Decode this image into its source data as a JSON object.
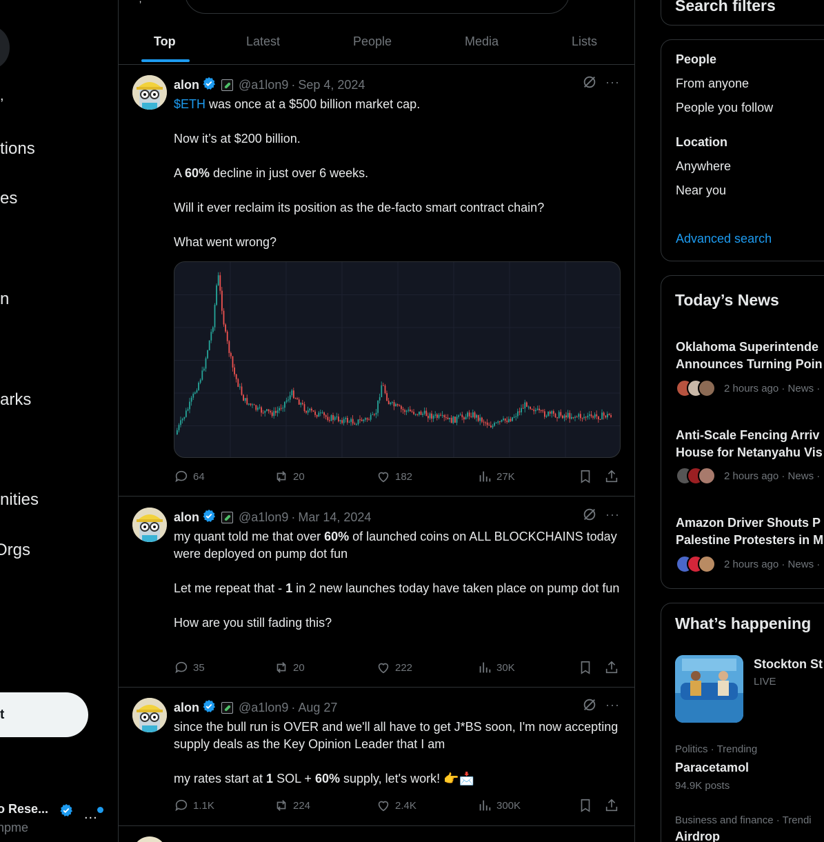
{
  "left_nav": {
    "items": [
      "tions",
      "es",
      "n",
      "arks",
      "nities",
      " Orgs"
    ],
    "post_label": "t",
    "account_name": "o Rese...",
    "account_handle": "npme",
    "more": "..."
  },
  "tabs": [
    "Top",
    "Latest",
    "People",
    "Media",
    "Lists"
  ],
  "tweets": [
    {
      "name": "alon",
      "handle": "@a1lon9",
      "date": "Sep 4, 2024",
      "cashtag": "$ETH",
      "body": [
        " was once at a $500 billion market cap.",
        "",
        "Now it’s at $200 billion.",
        "",
        "A ",
        "60%",
        " decline in just over 6 weeks.",
        "",
        "Will it ever reclaim its position as the de-facto smart contract chain?",
        "",
        "What went wrong?"
      ],
      "replies": "64",
      "reposts": "20",
      "likes": "182",
      "views": "27K"
    },
    {
      "name": "alon",
      "handle": "@a1lon9",
      "date": "Mar 14, 2024",
      "body": [
        "my quant told me that over ",
        "60%",
        " of launched coins on ALL BLOCKCHAINS today were deployed on pump dot fun",
        "Let me repeat that - ",
        "1",
        " in 2 new launches today have taken place on pump dot fun",
        "How are you still fading this?"
      ],
      "replies": "35",
      "reposts": "20",
      "likes": "222",
      "views": "30K"
    },
    {
      "name": "alon",
      "handle": "@a1lon9",
      "date": "Aug 27",
      "body": [
        "since the bull run is OVER and we'll all have to get J*BS soon, I'm now accepting supply deals as the Key Opinion Leader that I am",
        "my rates start at ",
        "1",
        " SOL + ",
        "60%",
        " supply, let's work! 👉📩"
      ],
      "replies": "1.1K",
      "reposts": "224",
      "likes": "2.4K",
      "views": "300K"
    }
  ],
  "search_filters": {
    "title": "Search filters",
    "people_label": "People",
    "people_options": [
      "From anyone",
      "People you follow"
    ],
    "location_label": "Location",
    "location_options": [
      "Anywhere",
      "Near you"
    ],
    "advanced_link": "Advanced search"
  },
  "todays_news": {
    "title": "Today’s News",
    "items": [
      {
        "line1": "Oklahoma Superintende",
        "line2": "Announces Turning Poin",
        "meta": "2 hours ago · News ·"
      },
      {
        "line1": "Anti-Scale Fencing Arriv",
        "line2": "House for Netanyahu Vis",
        "meta": "2 hours ago · News ·"
      },
      {
        "line1": "Amazon Driver Shouts P",
        "line2": "Palestine Protesters in M",
        "meta": "2 hours ago · News ·"
      }
    ]
  },
  "whats_happening": {
    "title": "What’s happening",
    "feature_title": "Stockton St",
    "feature_status": "LIVE",
    "trends": [
      {
        "category": "Politics · Trending",
        "name": "Paracetamol",
        "count": "94.9K posts"
      },
      {
        "category": "Business and finance · Trendi",
        "name": "Airdrop",
        "count": ""
      }
    ]
  },
  "colors": {
    "accent": "#1d9bf0",
    "up_candle": "#26a69a",
    "down_candle": "#ef5350"
  }
}
